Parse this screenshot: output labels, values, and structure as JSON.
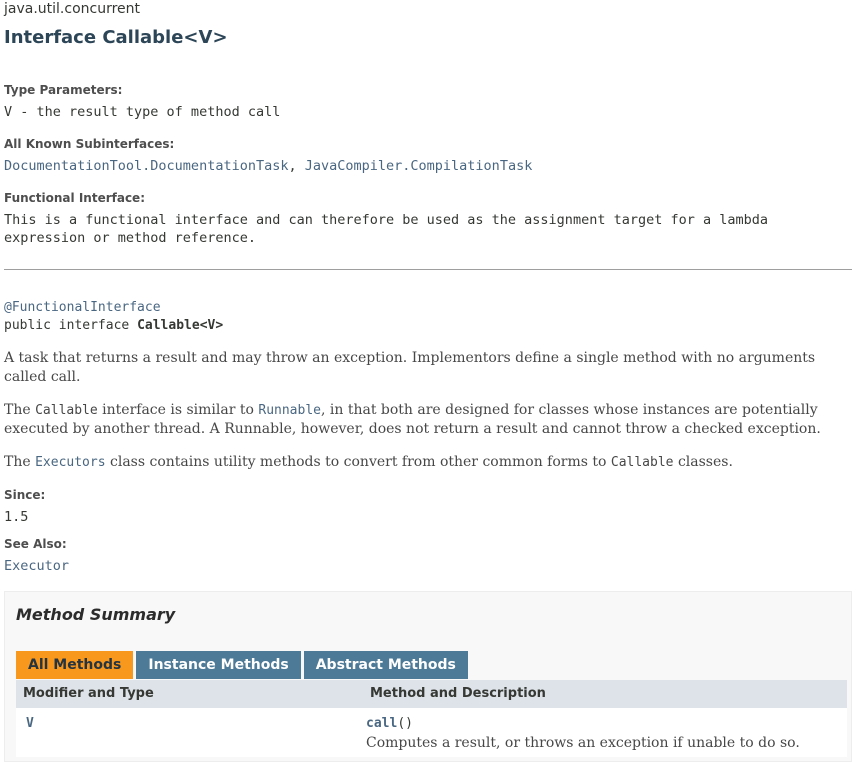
{
  "package": "java.util.concurrent",
  "title": "Interface Callable<V>",
  "type_parameters": {
    "label": "Type Parameters:",
    "value": "V - the result type of method call"
  },
  "subinterfaces": {
    "label": "All Known Subinterfaces:",
    "items": [
      "DocumentationTool.DocumentationTask",
      "JavaCompiler.CompilationTask"
    ],
    "sep": ", "
  },
  "functional": {
    "label": "Functional Interface:",
    "value": "This is a functional interface and can therefore be used as the assignment target for a lambda expression or method reference."
  },
  "signature": {
    "annotation": "@FunctionalInterface",
    "prefix": "public interface ",
    "name": "Callable",
    "suffix": "<V>"
  },
  "description": {
    "p1": "A task that returns a result and may throw an exception. Implementors define a single method with no arguments called call.",
    "p2a": "The ",
    "p2code": "Callable",
    "p2b": " interface is similar to ",
    "p2link": "Runnable",
    "p2c": ", in that both are designed for classes whose instances are potentially executed by another thread. A Runnable, however, does not return a result and",
    "p2line2": "cannot throw a checked exception.",
    "p3a": "The ",
    "p3link": "Executors",
    "p3b": " class contains utility methods to convert from other common forms to ",
    "p3code": "Callable",
    "p3c": " classes."
  },
  "since": {
    "label": "Since:",
    "value": "1.5"
  },
  "see_also": {
    "label": "See Also:",
    "link": "Executor"
  },
  "method_summary": {
    "title": "Method Summary",
    "tabs": [
      {
        "label": "All Methods",
        "active": true
      },
      {
        "label": "Instance Methods",
        "active": false
      },
      {
        "label": "Abstract Methods",
        "active": false
      }
    ],
    "columns": [
      "Modifier and Type",
      "Method and Description"
    ],
    "rows": [
      {
        "type": "V",
        "method": "call",
        "params": "()",
        "description": "Computes a result, or throws an exception if unable to do so."
      }
    ]
  },
  "colors": {
    "link": "#4A6782",
    "active_tab": "#F8981D",
    "tab": "#4D7A97",
    "header_row": "#dee3e9",
    "title": "#2c4557"
  }
}
